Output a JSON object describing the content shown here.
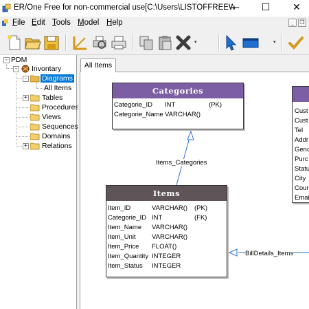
{
  "window": {
    "title": "ER/One Free for non-commercial use[C:\\Users\\LISTOFFREEWARE\\D...",
    "minimize_glyph": "—",
    "maximize_glyph": "☐",
    "close_glyph": "✕"
  },
  "menu": {
    "items": [
      {
        "key": "F",
        "rest": "ile"
      },
      {
        "key": "E",
        "rest": "dit"
      },
      {
        "key": "T",
        "rest": "ools"
      },
      {
        "key": "M",
        "rest": "odel"
      },
      {
        "key": "H",
        "rest": "elp"
      }
    ],
    "mdi_min": "_",
    "mdi_restore": "❐"
  },
  "toolbar": {
    "icons": [
      "new-icon",
      "open-icon",
      "save-icon",
      "print-preview-icon",
      "print-icon",
      "copy-icon",
      "paste-icon",
      "delete-icon",
      "pointer-icon",
      "entity-icon",
      "check-icon"
    ],
    "accent": "#1f6fd1"
  },
  "tree": {
    "root": "PDM",
    "project": "Invontary",
    "diagrams": "Diagrams",
    "all_items": "All Items",
    "tables": "Tables",
    "procedures": "Procedures",
    "views": "Views",
    "sequences": "Sequences",
    "domains": "Domains",
    "relations": "Relations"
  },
  "tabs": {
    "active": "All Items"
  },
  "diagram": {
    "header_color": "#7b5ea3",
    "header_color_dark": "#5f5558",
    "categories": {
      "title": "Categories",
      "rows": [
        {
          "name": "Categorie_ID",
          "type": "INT",
          "key": "(PK)"
        },
        {
          "name": "Categorie_Name",
          "type": "VARCHAR()",
          "key": ""
        }
      ]
    },
    "items": {
      "title": "Items",
      "rows": [
        {
          "name": "Item_ID",
          "type": "VARCHAR()",
          "key": "(PK)"
        },
        {
          "name": "Categorie_ID",
          "type": "INT",
          "key": "(FK)"
        },
        {
          "name": "Item_Name",
          "type": "VARCHAR()",
          "key": ""
        },
        {
          "name": "Item_Unit",
          "type": "VARCHAR()",
          "key": ""
        },
        {
          "name": "Item_Price",
          "type": "FLOAT()",
          "key": ""
        },
        {
          "name": "Item_Quantity",
          "type": "INTEGER",
          "key": ""
        },
        {
          "name": "Item_Status",
          "type": "INTEGER",
          "key": ""
        }
      ]
    },
    "customer_partial": {
      "rows": [
        "Cust",
        "Cust",
        "Tel",
        "Addr",
        "Gend",
        "Purc",
        "Statu",
        "City",
        "Cour",
        "Emai"
      ]
    },
    "relations": {
      "items_categories": "Items_Categories",
      "billdetails_items": "BillDetails_Items"
    }
  }
}
